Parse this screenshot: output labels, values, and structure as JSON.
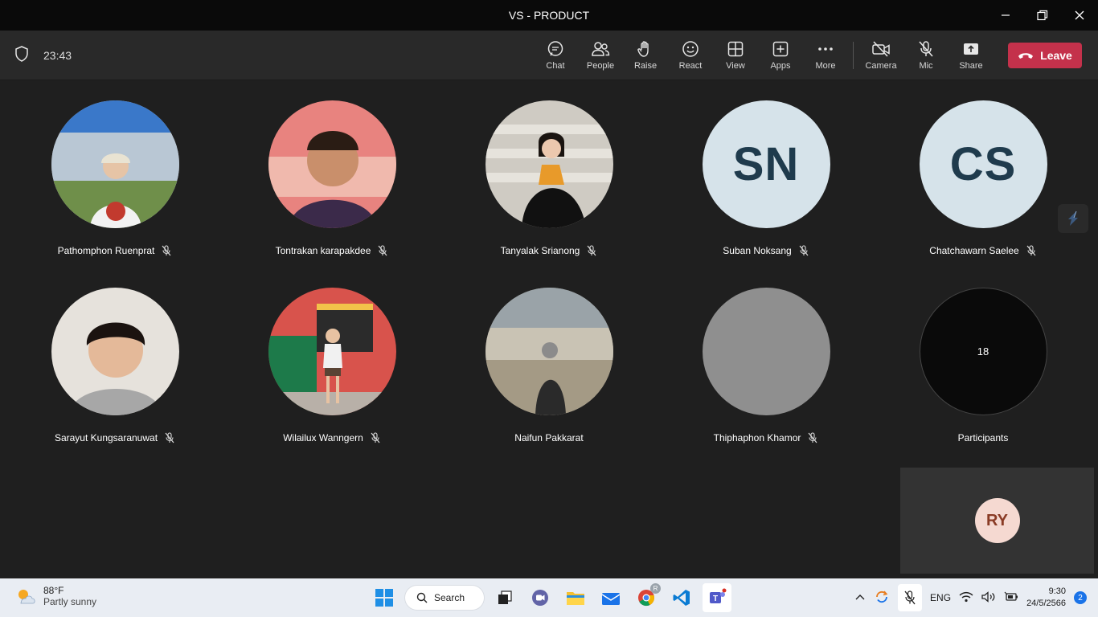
{
  "window": {
    "title": "VS - PRODUCT"
  },
  "toolbar": {
    "timer": "23:43",
    "buttons": [
      {
        "label": "Chat",
        "icon": "chat-icon"
      },
      {
        "label": "People",
        "icon": "people-icon"
      },
      {
        "label": "Raise",
        "icon": "raise-hand-icon"
      },
      {
        "label": "React",
        "icon": "react-icon"
      },
      {
        "label": "View",
        "icon": "view-grid-icon"
      },
      {
        "label": "Apps",
        "icon": "apps-plus-icon"
      },
      {
        "label": "More",
        "icon": "more-icon"
      }
    ],
    "media": [
      {
        "label": "Camera",
        "icon": "camera-off-icon"
      },
      {
        "label": "Mic",
        "icon": "mic-off-icon"
      },
      {
        "label": "Share",
        "icon": "share-icon"
      }
    ],
    "leave_label": "Leave",
    "leave_color": "#c4314b"
  },
  "participants": [
    {
      "name": "Pathomphon Ruenprat",
      "muted": true,
      "avatar": "photo"
    },
    {
      "name": "Tontrakan karapakdee",
      "muted": true,
      "avatar": "photo"
    },
    {
      "name": "Tanyalak Srianong",
      "muted": true,
      "avatar": "photo"
    },
    {
      "name": "Suban Noksang",
      "muted": true,
      "avatar": "initials",
      "initials": "SN"
    },
    {
      "name": "Chatchawarn Saelee",
      "muted": true,
      "avatar": "initials",
      "initials": "CS"
    },
    {
      "name": "Sarayut Kungsaranuwat",
      "muted": true,
      "avatar": "photo"
    },
    {
      "name": "Wilailux Wanngern",
      "muted": true,
      "avatar": "photo"
    },
    {
      "name": "Naifun Pakkarat",
      "muted": false,
      "avatar": "photo"
    },
    {
      "name": "Thiphaphon Khamor",
      "muted": true,
      "avatar": "gray"
    }
  ],
  "overflow": {
    "count": "18",
    "label": "Participants"
  },
  "self_view": {
    "initials": "RY"
  },
  "taskbar": {
    "weather_temp": "88°F",
    "weather_desc": "Partly sunny",
    "search_label": "Search",
    "language": "ENG",
    "time": "9:30",
    "date": "24/5/2566",
    "notification_count": "2",
    "chrome_profile": "R"
  }
}
